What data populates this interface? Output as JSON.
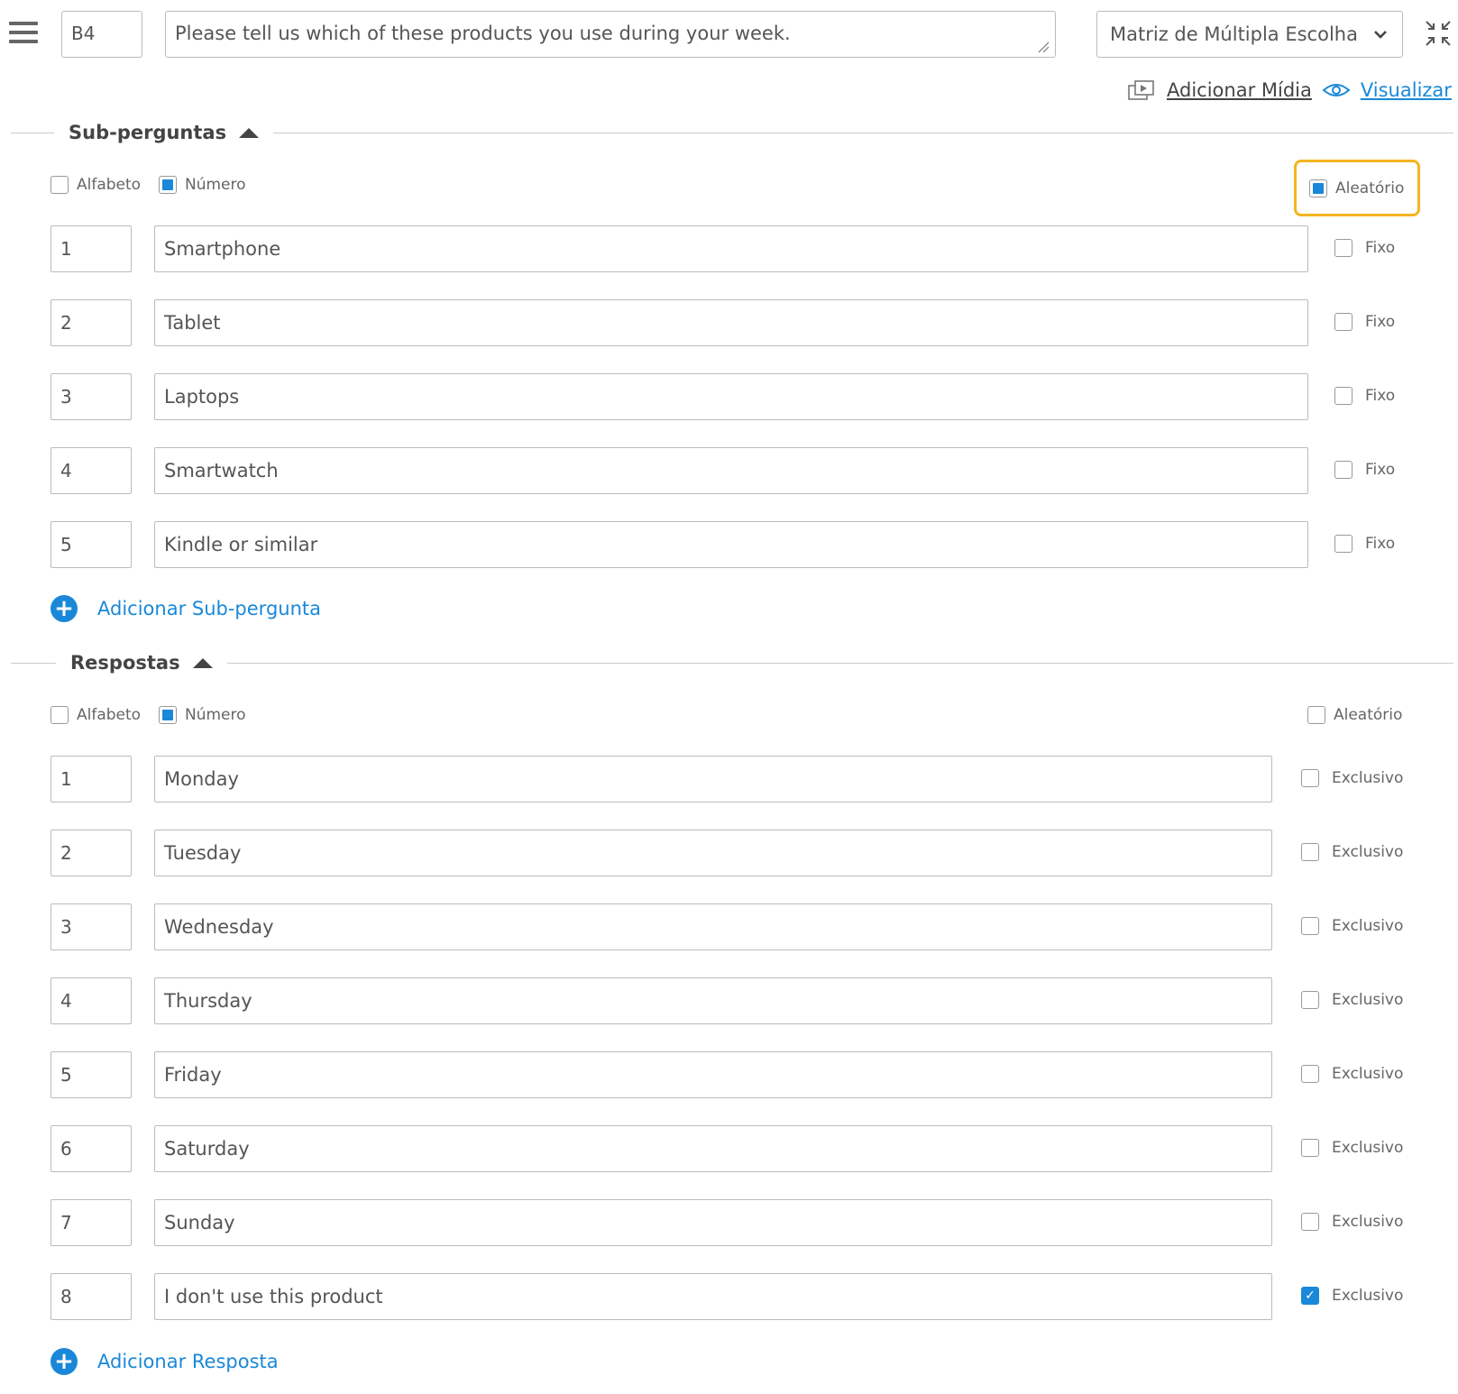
{
  "header": {
    "code": "B4",
    "question": "Please tell us which of these products you use during your week.",
    "question_type": "Matriz de Múltipla Escolha",
    "add_media": "Adicionar Mídia",
    "preview": "Visualizar"
  },
  "subquestions": {
    "title": "Sub-perguntas",
    "alphabet_label": "Alfabeto",
    "number_label": "Número",
    "random_label": "Aleatório",
    "fixed_label": "Fixo",
    "add_label": "Adicionar Sub-pergunta",
    "items": [
      {
        "num": "1",
        "text": "Smartphone"
      },
      {
        "num": "2",
        "text": "Tablet"
      },
      {
        "num": "3",
        "text": "Laptops"
      },
      {
        "num": "4",
        "text": "Smartwatch"
      },
      {
        "num": "5",
        "text": "Kindle or similar"
      }
    ]
  },
  "answers": {
    "title": "Respostas",
    "alphabet_label": "Alfabeto",
    "number_label": "Número",
    "random_label": "Aleatório",
    "exclusive_label": "Exclusivo",
    "add_label": "Adicionar Resposta",
    "items": [
      {
        "num": "1",
        "text": "Monday",
        "exclusive": false
      },
      {
        "num": "2",
        "text": "Tuesday",
        "exclusive": false
      },
      {
        "num": "3",
        "text": "Wednesday",
        "exclusive": false
      },
      {
        "num": "4",
        "text": "Thursday",
        "exclusive": false
      },
      {
        "num": "5",
        "text": "Friday",
        "exclusive": false
      },
      {
        "num": "6",
        "text": "Saturday",
        "exclusive": false
      },
      {
        "num": "7",
        "text": "Sunday",
        "exclusive": false
      },
      {
        "num": "8",
        "text": "I don't use this product",
        "exclusive": true
      }
    ]
  },
  "colors": {
    "accent": "#1a88d8",
    "highlight": "#f5b41f"
  }
}
